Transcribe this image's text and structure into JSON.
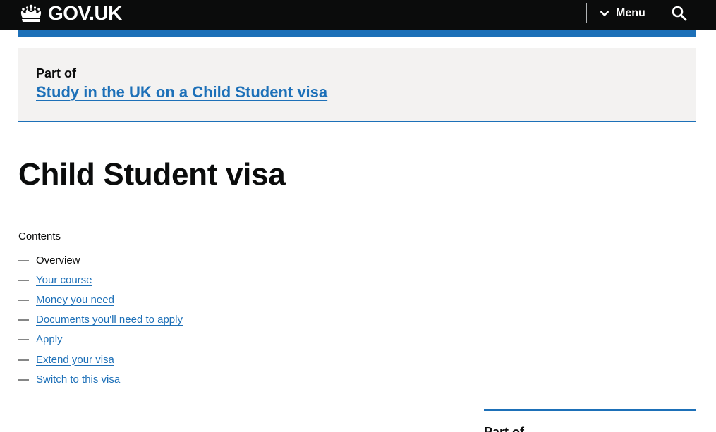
{
  "header": {
    "logo_text": "GOV.UK",
    "menu_label": "Menu",
    "search_icon": "search-icon",
    "crown_icon": "crown-icon",
    "menu_icon": "chevron-down-icon"
  },
  "part_of": {
    "label": "Part of",
    "link_text": "Study in the UK on a Child Student visa"
  },
  "page": {
    "title": "Child Student visa"
  },
  "contents": {
    "heading": "Contents",
    "dash": "—",
    "items": [
      {
        "label": "Overview",
        "current": true
      },
      {
        "label": "Your course",
        "current": false
      },
      {
        "label": "Money you need",
        "current": false
      },
      {
        "label": "Documents you'll need to apply",
        "current": false
      },
      {
        "label": "Apply",
        "current": false
      },
      {
        "label": "Extend your visa",
        "current": false
      },
      {
        "label": "Switch to this visa",
        "current": false
      }
    ]
  },
  "sidebar": {
    "part_of_label": "Part of"
  },
  "colors": {
    "header_bg": "#0b0c0c",
    "brand_blue": "#1d70b8",
    "panel_bg": "#f3f2f1",
    "text": "#0b0c0c",
    "rule_grey": "#b1b4b6"
  }
}
